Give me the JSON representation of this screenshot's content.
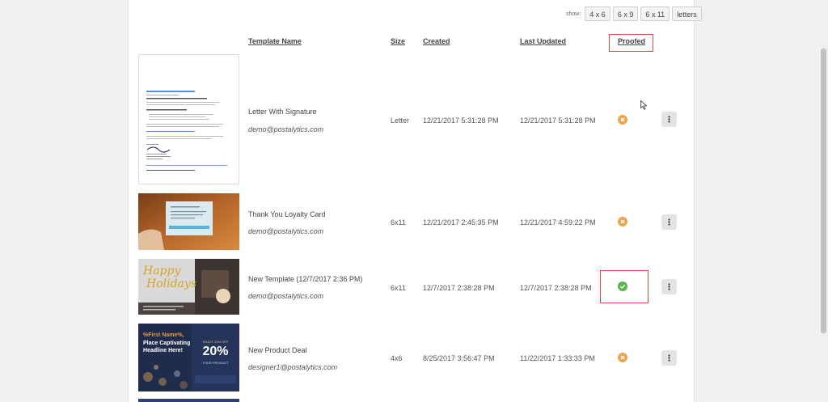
{
  "show": {
    "label": "show:",
    "options": [
      "4 x 6",
      "6 x 9",
      "6 x 11",
      "letters"
    ]
  },
  "headers": {
    "template_name": "Template Name",
    "size": "Size",
    "created": "Created",
    "last_updated": "Last Updated",
    "proofed": "Proofed"
  },
  "rows": [
    {
      "name": "Letter With Signature",
      "email": "demo@postalytics.com",
      "size": "Letter",
      "created": "12/21/2017 5:31:28 PM",
      "updated": "12/21/2017 5:31:28 PM",
      "proofed": false
    },
    {
      "name": "Thank You Loyalty Card",
      "email": "demo@postalytics.com",
      "size": "6x11",
      "created": "12/21/2017 2:45:35 PM",
      "updated": "12/21/2017 4:59:22 PM",
      "proofed": false
    },
    {
      "name": "New Template (12/7/2017 2:36 PM)",
      "email": "demo@postalytics.com",
      "size": "6x11",
      "created": "12/7/2017 2:38:28 PM",
      "updated": "12/7/2017 2:38:28 PM",
      "proofed": true
    },
    {
      "name": "New Product Deal",
      "email": "designer1@postalytics.com",
      "size": "4x6",
      "created": "8/25/2017 3:56:47 PM",
      "updated": "11/22/2017 1:33:33 PM",
      "proofed": false
    }
  ],
  "thumbs": {
    "holiday": {
      "line1": "Happy",
      "line2": "Holidays"
    },
    "deal": {
      "headline1": "%First Name%,",
      "headline2": "Place Captivating",
      "headline3": "Headline Here!",
      "pct": "20%",
      "top": "ENJOY 20% OFF",
      "bottom": "YOUR PRODUCT"
    }
  },
  "colors": {
    "proofed_ok": "#56b64e",
    "not_proofed": "#eda54a",
    "highlight": "#e0454a"
  }
}
